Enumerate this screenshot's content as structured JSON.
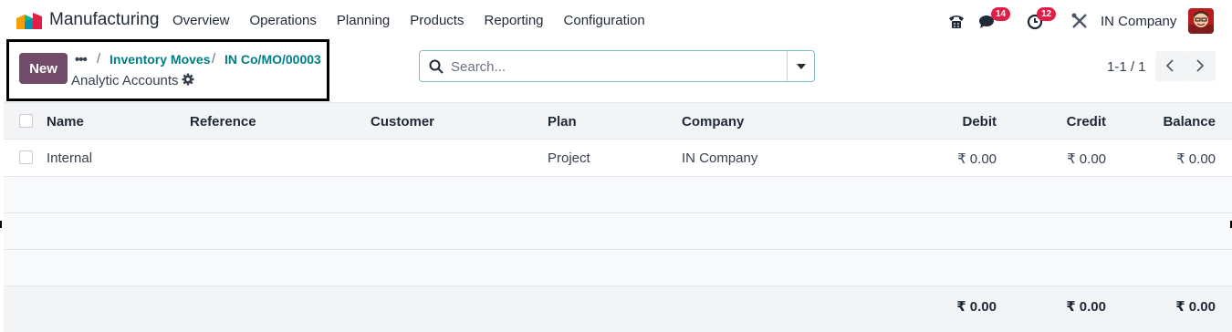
{
  "navbar": {
    "app_name": "Manufacturing",
    "menu": [
      "Overview",
      "Operations",
      "Planning",
      "Products",
      "Reporting",
      "Configuration"
    ],
    "messages_count": "14",
    "activities_count": "12",
    "company": "IN Company",
    "icons": [
      "phone-icon",
      "chat-icon",
      "clock-icon",
      "tools-icon",
      "user-avatar"
    ]
  },
  "control_panel": {
    "new_label": "New",
    "breadcrumbs": [
      "Inventory Moves",
      "IN Co/MO/00003"
    ],
    "separator": "/",
    "title": "Analytic Accounts",
    "search_placeholder": "Search...",
    "pager": "1-1 / 1"
  },
  "table": {
    "columns": [
      "Name",
      "Reference",
      "Customer",
      "Plan",
      "Company",
      "Debit",
      "Credit",
      "Balance"
    ],
    "rows": [
      {
        "name": "Internal",
        "reference": "",
        "customer": "",
        "plan": "Project",
        "company": "IN Company",
        "debit": "₹ 0.00",
        "credit": "₹ 0.00",
        "balance": "₹ 0.00"
      }
    ],
    "totals": {
      "debit": "₹ 0.00",
      "credit": "₹ 0.00",
      "balance": "₹ 0.00"
    }
  },
  "colors": {
    "brand": "#714b67",
    "link": "#017e84",
    "badge": "#e11d48"
  }
}
